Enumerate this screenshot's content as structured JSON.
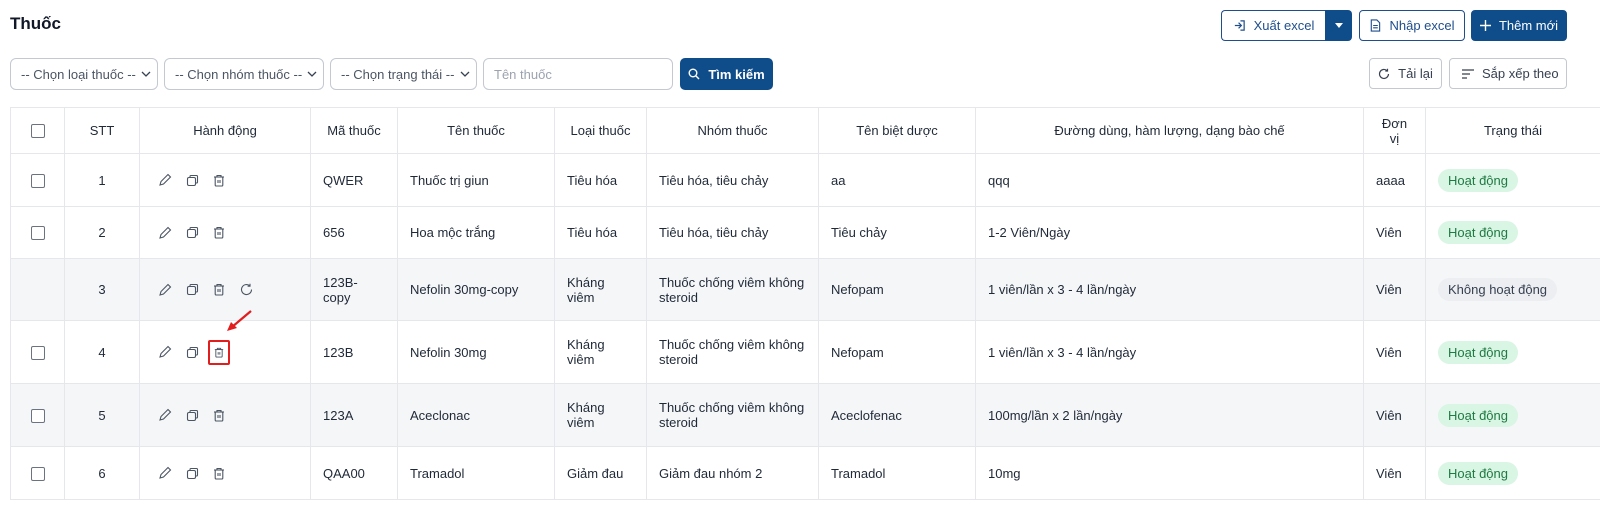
{
  "page": {
    "title": "Thuốc"
  },
  "toolbar": {
    "export_label": "Xuất excel",
    "import_label": "Nhập excel",
    "add_label": "Thêm mới"
  },
  "filters": {
    "type_select": "-- Chọn loại thuốc --",
    "group_select": "-- Chọn nhóm thuốc --",
    "status_select": "-- Chọn trạng thái --",
    "name_placeholder": "Tên thuốc",
    "search_label": "Tìm kiếm",
    "reload_label": "Tải lại",
    "sort_label": "Sắp xếp theo"
  },
  "table": {
    "headers": [
      "STT",
      "Hành động",
      "Mã thuốc",
      "Tên thuốc",
      "Loại thuốc",
      "Nhóm thuốc",
      "Tên biệt dược",
      "Đường dùng, hàm lượng, dạng bào chế",
      "Đơn vị",
      "Trạng thái"
    ],
    "rows": [
      {
        "stt": "1",
        "code": "QWER",
        "name": "Thuốc trị giun",
        "type": "Tiêu hóa",
        "group": "Tiêu hóa, tiêu chảy",
        "brand": "aa",
        "route": "qqq",
        "unit": "aaaa",
        "status": "Hoạt động"
      },
      {
        "stt": "2",
        "code": "656",
        "name": "Hoa mộc trắng",
        "type": "Tiêu hóa",
        "group": "Tiêu hóa, tiêu chảy",
        "brand": "Tiêu chảy",
        "route": "1-2 Viên/Ngày",
        "unit": "Viên",
        "status": "Hoạt động"
      },
      {
        "stt": "3",
        "code": "123B-copy",
        "name": "Nefolin 30mg-copy",
        "type": "Kháng viêm",
        "group": "Thuốc chống viêm không steroid",
        "brand": "Nefopam",
        "route": "1 viên/lần x 3 - 4 lần/ngày",
        "unit": "Viên",
        "status": "Không hoạt động"
      },
      {
        "stt": "4",
        "code": "123B",
        "name": "Nefolin 30mg",
        "type": "Kháng viêm",
        "group": "Thuốc chống viêm không steroid",
        "brand": "Nefopam",
        "route": "1 viên/lần x 3 - 4 lần/ngày",
        "unit": "Viên",
        "status": "Hoạt động"
      },
      {
        "stt": "5",
        "code": "123A",
        "name": "Aceclonac",
        "type": "Kháng viêm",
        "group": "Thuốc chống viêm không steroid",
        "brand": "Aceclofenac",
        "route": "100mg/lần x 2 lần/ngày",
        "unit": "Viên",
        "status": "Hoạt động"
      },
      {
        "stt": "6",
        "code": "QAA00",
        "name": "Tramadol",
        "type": "Giảm đau",
        "group": "Giảm đau nhóm 2",
        "brand": "Tramadol",
        "route": "10mg",
        "unit": "Viên",
        "status": "Hoạt động"
      }
    ]
  },
  "colors": {
    "primary": "#0f4c8a",
    "active_badge_bg": "#d9f5e3",
    "active_badge_text": "#1f7a43",
    "inactive_badge_bg": "#eceef1",
    "highlight": "#e11d1d"
  },
  "icons": [
    "export-icon",
    "chevron-down-icon",
    "file-icon",
    "plus-icon",
    "search-icon",
    "refresh-icon",
    "sort-icon",
    "pencil-icon",
    "copy-icon",
    "trash-icon",
    "restore-icon",
    "arrow-icon"
  ]
}
